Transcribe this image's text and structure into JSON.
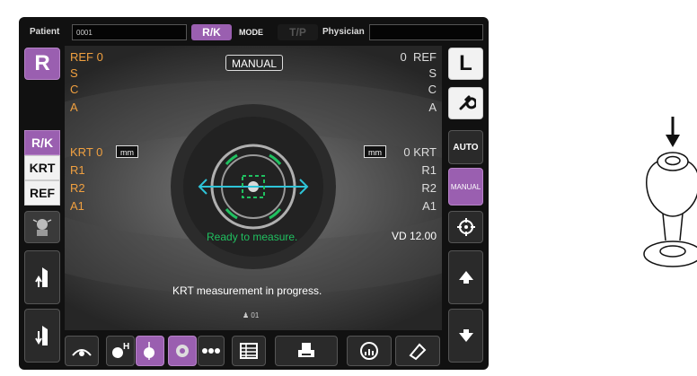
{
  "topbar": {
    "patient_label": "Patient",
    "patient_id": "0001",
    "mode_rk": "R/K",
    "mode_label": "MODE",
    "mode_tp": "T/P",
    "physician_label": "Physician",
    "physician_value": ""
  },
  "eye_side": {
    "left_badge": "R",
    "right_badge": "L"
  },
  "ref_left": {
    "title": "REF",
    "value": "0",
    "s": "S",
    "c": "C",
    "a": "A"
  },
  "ref_right": {
    "title": "REF",
    "value": "0",
    "s": "S",
    "c": "C",
    "a": "A"
  },
  "manual_badge": "MANUAL",
  "krt_left": {
    "title": "KRT",
    "value": "0",
    "unit": "mm",
    "r1": "R1",
    "r2": "R2",
    "a1": "A1"
  },
  "krt_right": {
    "title": "KRT",
    "value": "0",
    "unit": "mm",
    "r1": "R1",
    "r2": "R2",
    "a1": "A1"
  },
  "status": {
    "ready": "Ready to measure.",
    "vd": "VD 12.00",
    "progress": "KRT measurement in progress.",
    "count": "01"
  },
  "side_modes": [
    "R/K",
    "KRT",
    "REF"
  ],
  "right_panel": {
    "auto": "AUTO",
    "manual": "MANUAL"
  },
  "colors": {
    "accent": "#9a5fb0",
    "ref_text": "#f0a040",
    "ready_text": "#20c060",
    "target": "#2ec4d8"
  }
}
